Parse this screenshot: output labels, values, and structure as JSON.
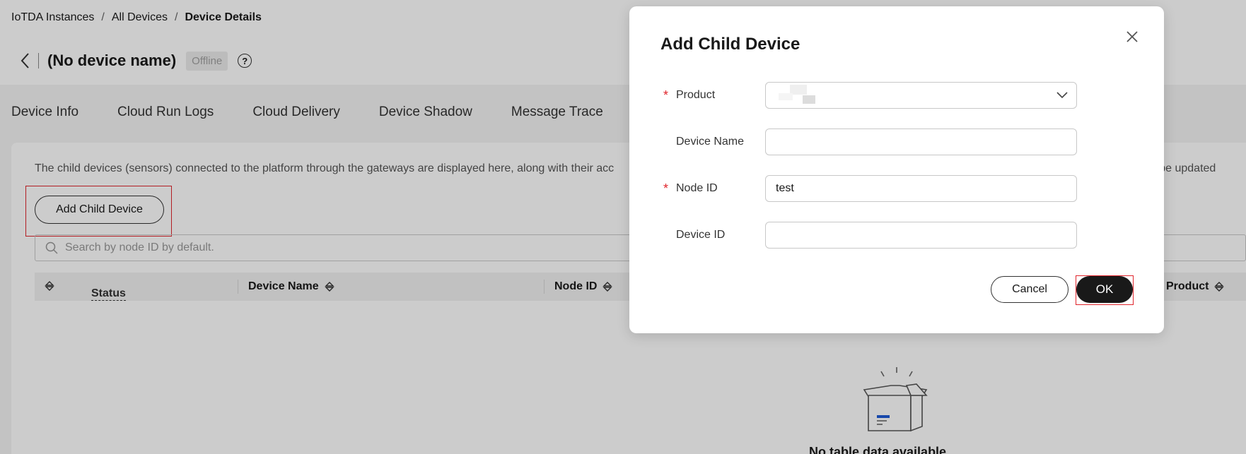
{
  "breadcrumb": {
    "items": [
      "IoTDA Instances",
      "All Devices"
    ],
    "separator": "/",
    "current": "Device Details"
  },
  "header": {
    "title": "(No device name)",
    "status_badge": "Offline",
    "help_glyph": "?"
  },
  "tabs": [
    "Device Info",
    "Cloud Run Logs",
    "Cloud Delivery",
    "Device Shadow",
    "Message Trace"
  ],
  "child_devices": {
    "description": "The child devices (sensors) connected to the platform through the gateways are displayed here, along with their acc",
    "description_tail": "ll not be updated",
    "add_button": "Add Child Device",
    "search_placeholder": "Search by node ID by default.",
    "table_headers": {
      "status": "Status",
      "device_name": "Device Name",
      "node_id": "Node ID",
      "product": "Product"
    },
    "empty_text": "No table data available."
  },
  "dialog": {
    "title": "Add Child Device",
    "fields": {
      "product": {
        "label": "Product",
        "required_mark": "*",
        "value": ""
      },
      "device_name": {
        "label": "Device Name",
        "value": ""
      },
      "node_id": {
        "label": "Node ID",
        "required_mark": "*",
        "value": "test"
      },
      "device_id": {
        "label": "Device ID",
        "value": ""
      }
    },
    "cancel_label": "Cancel",
    "ok_label": "OK"
  },
  "colors": {
    "required": "#e0252c",
    "primary_button": "#191919",
    "highlight_box": "#e0252c"
  }
}
